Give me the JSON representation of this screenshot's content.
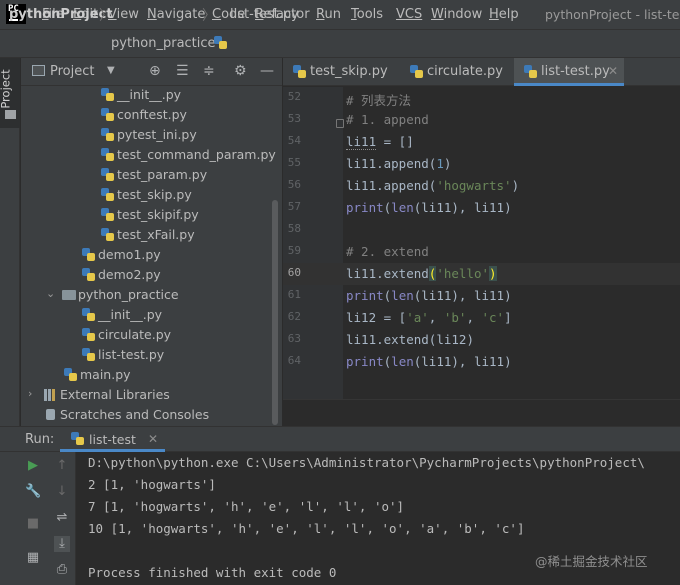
{
  "menu": {
    "items": [
      {
        "label": "File",
        "mn": "F",
        "rest": "ile"
      },
      {
        "label": "Edit",
        "mn": "E",
        "rest": "dit"
      },
      {
        "label": "View",
        "mn": "V",
        "rest": "iew"
      },
      {
        "label": "Navigate",
        "mn": "N",
        "rest": "avigate"
      },
      {
        "label": "Code",
        "mn": "C",
        "rest": "ode"
      },
      {
        "label": "Refactor",
        "mn": "R",
        "rest": "efactor"
      },
      {
        "label": "Run",
        "mn": "R",
        "rest": "un",
        "ulen": 1
      },
      {
        "label": "Tools",
        "mn": "T",
        "rest": "ools"
      },
      {
        "label": "VCS",
        "mn": "VCS",
        "rest": ""
      },
      {
        "label": "Window",
        "mn": "W",
        "rest": "indow"
      },
      {
        "label": "Help",
        "mn": "H",
        "rest": "elp"
      }
    ],
    "window_title": "pythonProject - list-test"
  },
  "breadcrumb": {
    "project": "pythonProject",
    "folder": "python_practice",
    "file": "list-test.py"
  },
  "project_panel": {
    "vtab_label": "Project",
    "title": "Project",
    "tree": [
      {
        "label": "__init__.py",
        "kind": "py"
      },
      {
        "label": "conftest.py",
        "kind": "py"
      },
      {
        "label": "pytest_ini.py",
        "kind": "py"
      },
      {
        "label": "test_command_param.py",
        "kind": "py"
      },
      {
        "label": "test_param.py",
        "kind": "py"
      },
      {
        "label": "test_skip.py",
        "kind": "py"
      },
      {
        "label": "test_skipif.py",
        "kind": "py"
      },
      {
        "label": "test_xFail.py",
        "kind": "py"
      },
      {
        "label": "demo1.py",
        "kind": "py"
      },
      {
        "label": "demo2.py",
        "kind": "py"
      },
      {
        "label": "python_practice",
        "kind": "folder"
      },
      {
        "label": "__init__.py",
        "kind": "py"
      },
      {
        "label": "circulate.py",
        "kind": "py"
      },
      {
        "label": "list-test.py",
        "kind": "py"
      },
      {
        "label": "main.py",
        "kind": "py"
      },
      {
        "label": "External Libraries",
        "kind": "lib"
      },
      {
        "label": "Scratches and Consoles",
        "kind": "scratch"
      }
    ]
  },
  "editor": {
    "tabs": [
      {
        "label": "test_skip.py"
      },
      {
        "label": "circulate.py"
      },
      {
        "label": "list-test.py",
        "active": true
      }
    ],
    "lines": [
      {
        "n": "52",
        "text": "# 列表方法"
      },
      {
        "n": "53",
        "text": "# 1. append"
      },
      {
        "n": "54",
        "text": "li11 = []"
      },
      {
        "n": "55",
        "text": "li11.append(1)"
      },
      {
        "n": "56",
        "text": "li11.append('hogwarts')"
      },
      {
        "n": "57",
        "text": "print(len(li11), li11)"
      },
      {
        "n": "58",
        "text": ""
      },
      {
        "n": "59",
        "text": "# 2. extend"
      },
      {
        "n": "60",
        "text": "li11.extend('hello')"
      },
      {
        "n": "61",
        "text": "print(len(li11), li11)"
      },
      {
        "n": "62",
        "text": "li12 = ['a', 'b', 'c']"
      },
      {
        "n": "63",
        "text": "li11.extend(li12)"
      },
      {
        "n": "64",
        "text": "print(len(li11), li11)"
      }
    ],
    "current_line": "60"
  },
  "run_panel": {
    "label": "Run:",
    "tab": "list-test",
    "console": [
      "D:\\python\\python.exe C:\\Users\\Administrator\\PycharmProjects\\pythonProject\\",
      "2 [1, 'hogwarts']",
      "7 [1, 'hogwarts', 'h', 'e', 'l', 'l', 'o']",
      "10 [1, 'hogwarts', 'h', 'e', 'l', 'l', 'o', 'a', 'b', 'c']",
      "",
      "Process finished with exit code 0"
    ]
  },
  "watermark": "@稀土掘金技术社区",
  "colors": {
    "accent": "#4a88c7",
    "comment": "#808080",
    "string": "#6a8759",
    "number": "#6897bb",
    "builtin": "#8888c6"
  }
}
